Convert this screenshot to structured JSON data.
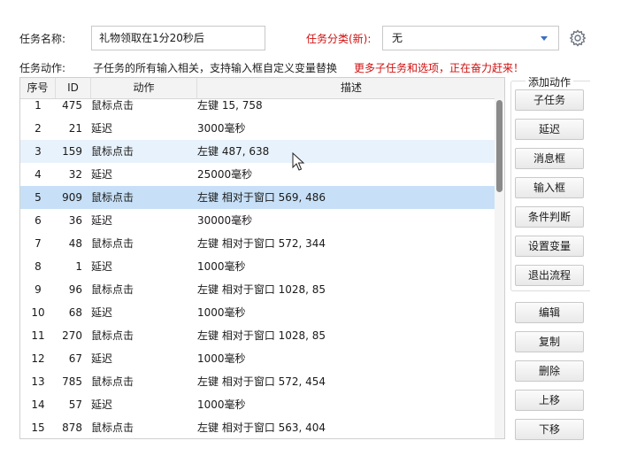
{
  "task": {
    "name_label": "任务名称:",
    "name_value": "礼物领取在1分20秒后",
    "category_label": "任务分类(新):",
    "category_value": "无",
    "actions_label": "任务动作:",
    "hint": "子任务的所有输入相关，支持输入框自定义变量替换",
    "hint_red": "更多子任务和选项，正在奋力赶来！"
  },
  "table": {
    "headers": [
      "序号",
      "ID",
      "动作",
      "描述"
    ],
    "rows": [
      {
        "no": "1",
        "id": "475",
        "action": "鼠标点击",
        "desc": "左键 15, 758"
      },
      {
        "no": "2",
        "id": "21",
        "action": "延迟",
        "desc": "3000毫秒"
      },
      {
        "no": "3",
        "id": "159",
        "action": "鼠标点击",
        "desc": "左键 487, 638"
      },
      {
        "no": "4",
        "id": "32",
        "action": "延迟",
        "desc": "25000毫秒"
      },
      {
        "no": "5",
        "id": "909",
        "action": "鼠标点击",
        "desc": "左键 相对于窗口 569, 486"
      },
      {
        "no": "6",
        "id": "36",
        "action": "延迟",
        "desc": "30000毫秒"
      },
      {
        "no": "7",
        "id": "48",
        "action": "鼠标点击",
        "desc": "左键 相对于窗口 572, 344"
      },
      {
        "no": "8",
        "id": "1",
        "action": "延迟",
        "desc": "1000毫秒"
      },
      {
        "no": "9",
        "id": "96",
        "action": "鼠标点击",
        "desc": "左键 相对于窗口 1028, 85"
      },
      {
        "no": "10",
        "id": "68",
        "action": "延迟",
        "desc": "1000毫秒"
      },
      {
        "no": "11",
        "id": "270",
        "action": "鼠标点击",
        "desc": "左键 相对于窗口 1028, 85"
      },
      {
        "no": "12",
        "id": "67",
        "action": "延迟",
        "desc": "1000毫秒"
      },
      {
        "no": "13",
        "id": "785",
        "action": "鼠标点击",
        "desc": "左键 相对于窗口 572, 454"
      },
      {
        "no": "14",
        "id": "57",
        "action": "延迟",
        "desc": "1000毫秒"
      },
      {
        "no": "15",
        "id": "878",
        "action": "鼠标点击",
        "desc": "左键 相对于窗口 563, 404"
      }
    ],
    "selected_row": 5,
    "hover_row": 3
  },
  "sidebar": {
    "group_title": "添加动作",
    "add_buttons": [
      "子任务",
      "延迟",
      "消息框",
      "输入框",
      "条件判断",
      "设置变量",
      "退出流程"
    ],
    "edit_buttons": [
      "编辑",
      "复制",
      "删除",
      "上移",
      "下移"
    ]
  },
  "colors": {
    "accent": "#3a6fc0",
    "warning_text": "#d01010",
    "selected_row": "#c7e0f7",
    "hover_row": "#e8f2fc"
  },
  "icons": {
    "settings": "gear-icon",
    "dropdown": "chevron-down-icon",
    "pointer": "mouse-cursor-icon"
  }
}
